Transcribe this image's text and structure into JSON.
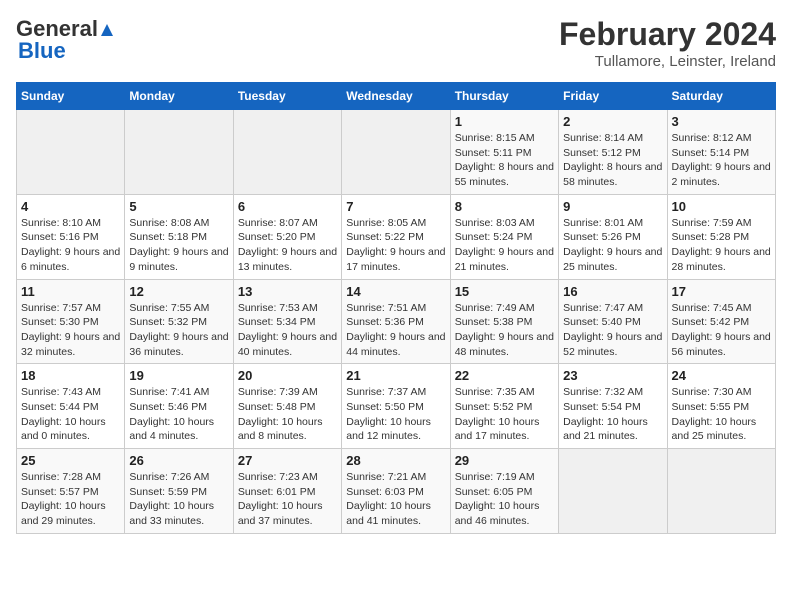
{
  "header": {
    "logo_general": "General",
    "logo_blue": "Blue",
    "title": "February 2024",
    "subtitle": "Tullamore, Leinster, Ireland"
  },
  "calendar": {
    "days_of_week": [
      "Sunday",
      "Monday",
      "Tuesday",
      "Wednesday",
      "Thursday",
      "Friday",
      "Saturday"
    ],
    "weeks": [
      [
        {
          "day": "",
          "info": ""
        },
        {
          "day": "",
          "info": ""
        },
        {
          "day": "",
          "info": ""
        },
        {
          "day": "",
          "info": ""
        },
        {
          "day": "1",
          "info": "Sunrise: 8:15 AM\nSunset: 5:11 PM\nDaylight: 8 hours and 55 minutes."
        },
        {
          "day": "2",
          "info": "Sunrise: 8:14 AM\nSunset: 5:12 PM\nDaylight: 8 hours and 58 minutes."
        },
        {
          "day": "3",
          "info": "Sunrise: 8:12 AM\nSunset: 5:14 PM\nDaylight: 9 hours and 2 minutes."
        }
      ],
      [
        {
          "day": "4",
          "info": "Sunrise: 8:10 AM\nSunset: 5:16 PM\nDaylight: 9 hours and 6 minutes."
        },
        {
          "day": "5",
          "info": "Sunrise: 8:08 AM\nSunset: 5:18 PM\nDaylight: 9 hours and 9 minutes."
        },
        {
          "day": "6",
          "info": "Sunrise: 8:07 AM\nSunset: 5:20 PM\nDaylight: 9 hours and 13 minutes."
        },
        {
          "day": "7",
          "info": "Sunrise: 8:05 AM\nSunset: 5:22 PM\nDaylight: 9 hours and 17 minutes."
        },
        {
          "day": "8",
          "info": "Sunrise: 8:03 AM\nSunset: 5:24 PM\nDaylight: 9 hours and 21 minutes."
        },
        {
          "day": "9",
          "info": "Sunrise: 8:01 AM\nSunset: 5:26 PM\nDaylight: 9 hours and 25 minutes."
        },
        {
          "day": "10",
          "info": "Sunrise: 7:59 AM\nSunset: 5:28 PM\nDaylight: 9 hours and 28 minutes."
        }
      ],
      [
        {
          "day": "11",
          "info": "Sunrise: 7:57 AM\nSunset: 5:30 PM\nDaylight: 9 hours and 32 minutes."
        },
        {
          "day": "12",
          "info": "Sunrise: 7:55 AM\nSunset: 5:32 PM\nDaylight: 9 hours and 36 minutes."
        },
        {
          "day": "13",
          "info": "Sunrise: 7:53 AM\nSunset: 5:34 PM\nDaylight: 9 hours and 40 minutes."
        },
        {
          "day": "14",
          "info": "Sunrise: 7:51 AM\nSunset: 5:36 PM\nDaylight: 9 hours and 44 minutes."
        },
        {
          "day": "15",
          "info": "Sunrise: 7:49 AM\nSunset: 5:38 PM\nDaylight: 9 hours and 48 minutes."
        },
        {
          "day": "16",
          "info": "Sunrise: 7:47 AM\nSunset: 5:40 PM\nDaylight: 9 hours and 52 minutes."
        },
        {
          "day": "17",
          "info": "Sunrise: 7:45 AM\nSunset: 5:42 PM\nDaylight: 9 hours and 56 minutes."
        }
      ],
      [
        {
          "day": "18",
          "info": "Sunrise: 7:43 AM\nSunset: 5:44 PM\nDaylight: 10 hours and 0 minutes."
        },
        {
          "day": "19",
          "info": "Sunrise: 7:41 AM\nSunset: 5:46 PM\nDaylight: 10 hours and 4 minutes."
        },
        {
          "day": "20",
          "info": "Sunrise: 7:39 AM\nSunset: 5:48 PM\nDaylight: 10 hours and 8 minutes."
        },
        {
          "day": "21",
          "info": "Sunrise: 7:37 AM\nSunset: 5:50 PM\nDaylight: 10 hours and 12 minutes."
        },
        {
          "day": "22",
          "info": "Sunrise: 7:35 AM\nSunset: 5:52 PM\nDaylight: 10 hours and 17 minutes."
        },
        {
          "day": "23",
          "info": "Sunrise: 7:32 AM\nSunset: 5:54 PM\nDaylight: 10 hours and 21 minutes."
        },
        {
          "day": "24",
          "info": "Sunrise: 7:30 AM\nSunset: 5:55 PM\nDaylight: 10 hours and 25 minutes."
        }
      ],
      [
        {
          "day": "25",
          "info": "Sunrise: 7:28 AM\nSunset: 5:57 PM\nDaylight: 10 hours and 29 minutes."
        },
        {
          "day": "26",
          "info": "Sunrise: 7:26 AM\nSunset: 5:59 PM\nDaylight: 10 hours and 33 minutes."
        },
        {
          "day": "27",
          "info": "Sunrise: 7:23 AM\nSunset: 6:01 PM\nDaylight: 10 hours and 37 minutes."
        },
        {
          "day": "28",
          "info": "Sunrise: 7:21 AM\nSunset: 6:03 PM\nDaylight: 10 hours and 41 minutes."
        },
        {
          "day": "29",
          "info": "Sunrise: 7:19 AM\nSunset: 6:05 PM\nDaylight: 10 hours and 46 minutes."
        },
        {
          "day": "",
          "info": ""
        },
        {
          "day": "",
          "info": ""
        }
      ]
    ]
  }
}
